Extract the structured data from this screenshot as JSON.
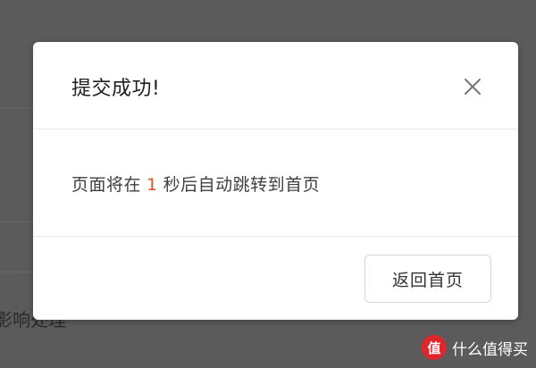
{
  "background": {
    "partial_text": "影响处理"
  },
  "modal": {
    "title": "提交成功!",
    "message_prefix": "页面将在",
    "countdown": "1",
    "message_suffix": "秒后自动跳转到首页",
    "home_button_label": "返回首页"
  },
  "watermark": {
    "logo_text": "值",
    "text": "什么值得买"
  },
  "colors": {
    "overlay": "#5b5b5b",
    "countdown_accent": "#d9541e",
    "watermark_logo": "#e0262c"
  }
}
